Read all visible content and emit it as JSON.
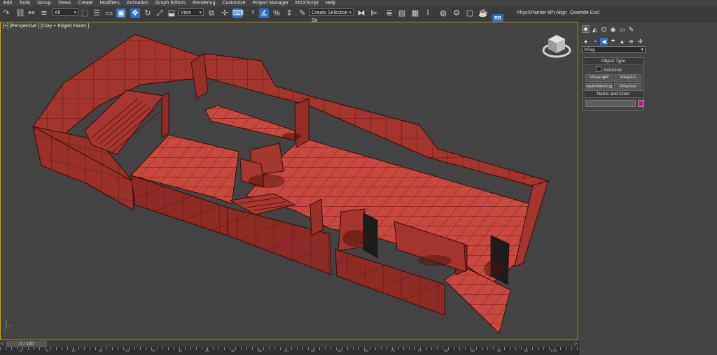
{
  "menu": [
    "Edit",
    "Tools",
    "Group",
    "Views",
    "Create",
    "Modifiers",
    "Animation",
    "Graph Editors",
    "Rendering",
    "Customize",
    "Project Manager",
    "MAXScript",
    "Help"
  ],
  "toolbar": {
    "selection_filter": "All",
    "ref_coord": "View",
    "named_selection": "Create Selection Se",
    "rb_label": "RB",
    "physx_painter": "PhysXPainter",
    "align": "8Pt Align",
    "override": "Override Excl"
  },
  "viewport": {
    "label": "[+] [Perspective ] [Clay + Edged Faces ]"
  },
  "panel": {
    "renderer_dropdown": "VRay",
    "object_type": {
      "title": "Object Type",
      "autogrid": "AutoGrid",
      "buttons": [
        "VRayLight",
        "VRayIES",
        "VRayAmbientLight",
        "VRaySun"
      ],
      "buttons_display": [
        "VRayLight",
        "VRayIES",
        "/ayAmbientLig",
        "VRaySun"
      ]
    },
    "name_and_color": {
      "title": "Name and Color",
      "name_value": "",
      "color": "#c2188a"
    }
  },
  "timeline": {
    "frame_display": "0 / 100",
    "ticks": [
      "0",
      "5",
      "10",
      "15",
      "20",
      "25",
      "30",
      "35",
      "40",
      "45",
      "50",
      "55",
      "60",
      "65",
      "70",
      "75",
      "80",
      "85",
      "90",
      "95",
      "100"
    ]
  },
  "colors": {
    "model": "#a3352e",
    "model_floor": "#c2473d",
    "viewport_bg": "#444444",
    "active_border": "#c9a227"
  }
}
